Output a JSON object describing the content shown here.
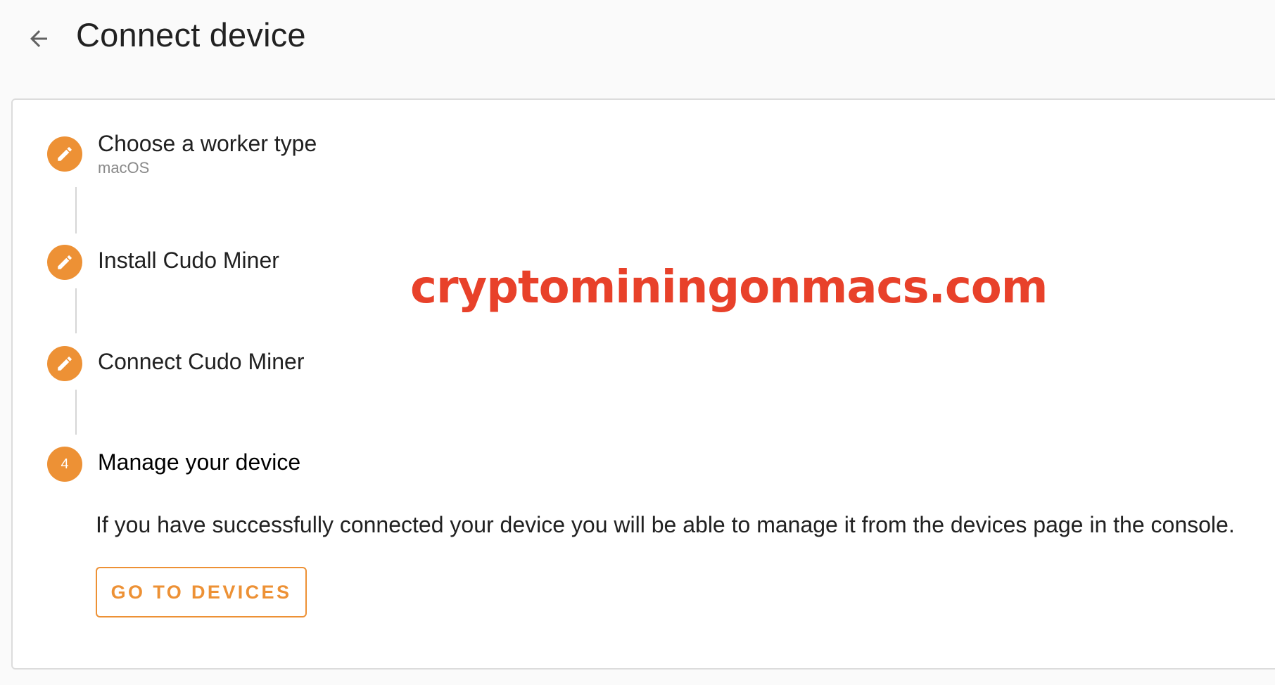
{
  "header": {
    "title": "Connect device",
    "back_icon": "arrow-left-icon"
  },
  "steps": [
    {
      "label": "Choose a worker type",
      "sublabel": "macOS",
      "icon": "pencil-icon",
      "state": "edit"
    },
    {
      "label": "Install Cudo Miner",
      "icon": "pencil-icon",
      "state": "edit"
    },
    {
      "label": "Connect Cudo Miner",
      "icon": "pencil-icon",
      "state": "edit"
    },
    {
      "label": "Manage your device",
      "number": "4",
      "state": "active"
    }
  ],
  "active_step": {
    "description": "If you have successfully connected your device you will be able to manage it from the devices page in the console.",
    "button_label": "GO TO DEVICES"
  },
  "watermark": "cryptominingonmacs.com",
  "colors": {
    "accent": "#ed9135",
    "watermark": "#e8412a",
    "background": "#fafafa",
    "card": "#ffffff"
  }
}
